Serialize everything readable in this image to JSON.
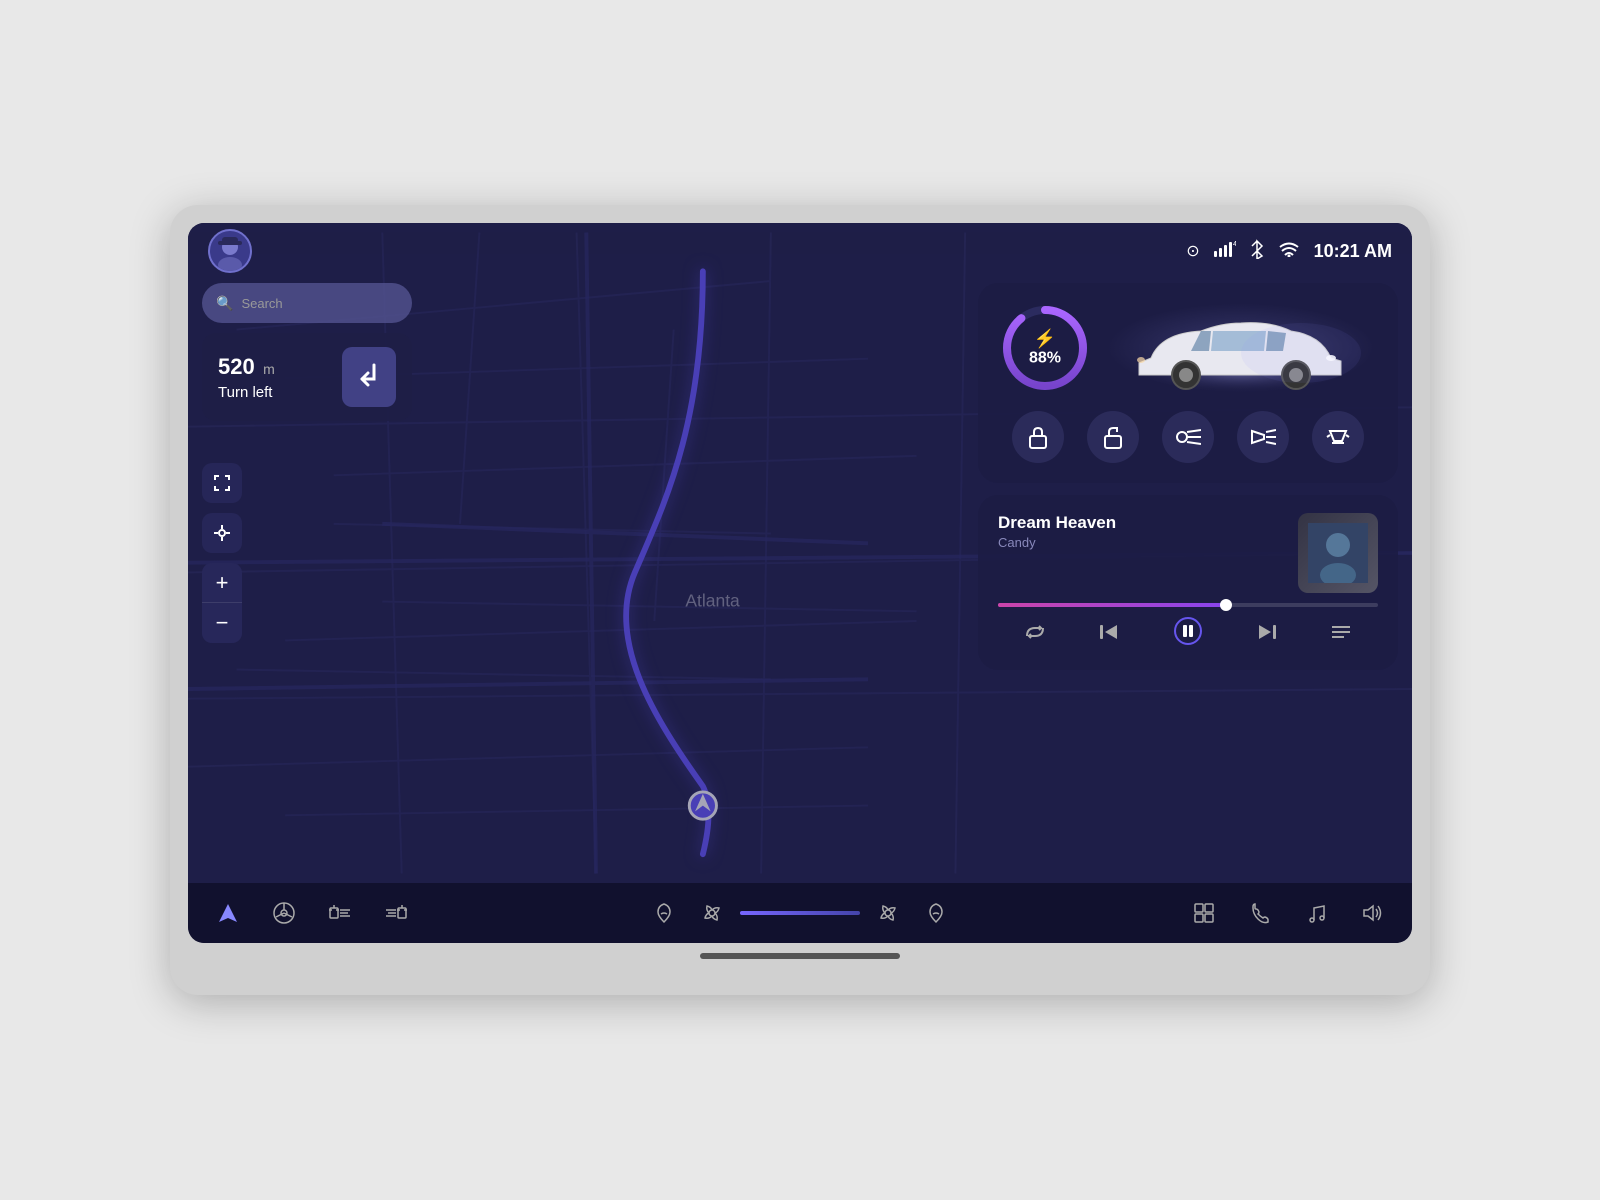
{
  "device": {
    "frame_color": "#d0d0d0"
  },
  "status_bar": {
    "time": "10:21 AM",
    "signal_icon": "📶",
    "bluetooth_icon": "🅱",
    "wifi_icon": "📡",
    "camera_icon": "👁"
  },
  "search": {
    "placeholder": "Search"
  },
  "navigation": {
    "distance": "520",
    "unit": "m",
    "instruction": "Turn left"
  },
  "map": {
    "city_label": "Atlanta"
  },
  "vehicle": {
    "battery_percent": "88%",
    "battery_label": "88%"
  },
  "vehicle_controls": [
    {
      "id": "lock",
      "icon": "🔒",
      "label": "Lock"
    },
    {
      "id": "unlock",
      "icon": "🔓",
      "label": "Unlock"
    },
    {
      "id": "highbeam",
      "icon": "💡",
      "label": "High Beam"
    },
    {
      "id": "headlight",
      "icon": "🔆",
      "label": "Headlight"
    },
    {
      "id": "interior-light",
      "icon": "🔅",
      "label": "Interior Light"
    }
  ],
  "music": {
    "song_title": "Dream Heaven",
    "song_artist": "Candy",
    "progress_percent": 60
  },
  "music_controls": [
    {
      "id": "repeat",
      "icon": "🔁",
      "label": "Repeat"
    },
    {
      "id": "prev",
      "icon": "⏮",
      "label": "Previous"
    },
    {
      "id": "pause",
      "icon": "⏸",
      "label": "Pause"
    },
    {
      "id": "next",
      "icon": "⏭",
      "label": "Next"
    },
    {
      "id": "playlist",
      "icon": "☰",
      "label": "Playlist"
    }
  ],
  "bottom_bar": {
    "left_buttons": [
      {
        "id": "navigation",
        "icon": "▲",
        "label": "Navigation",
        "active": true
      },
      {
        "id": "steering",
        "icon": "⊙",
        "label": "Steering"
      },
      {
        "id": "heat-front",
        "icon": "〜",
        "label": "Heat Front"
      },
      {
        "id": "heat-rear",
        "icon": "〜〜",
        "label": "Heat Rear"
      }
    ],
    "climate": {
      "heat_left_icon": "🔥",
      "fan_left_icon": "💨",
      "fan_right_icon": "💨",
      "heat_right_icon": "🔥"
    },
    "right_buttons": [
      {
        "id": "apps",
        "icon": "⊞",
        "label": "Apps"
      },
      {
        "id": "phone",
        "icon": "📞",
        "label": "Phone"
      },
      {
        "id": "music-nav",
        "icon": "♪",
        "label": "Music"
      },
      {
        "id": "volume",
        "icon": "🔊",
        "label": "Volume"
      }
    ]
  }
}
